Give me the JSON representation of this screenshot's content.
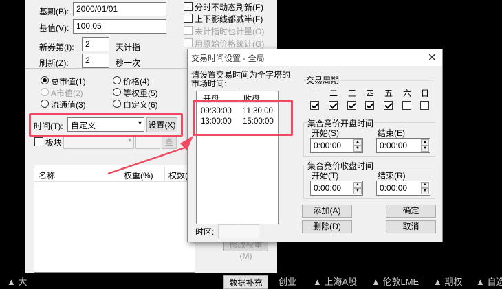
{
  "background": {
    "base_date_label": "基期(B):",
    "base_date_value": "2000/01/01",
    "base_value_label": "基值(V):",
    "base_value_value": "100.05",
    "new_stock_label": "新券第(I):",
    "new_stock_value": "2",
    "new_stock_suffix": "天计指",
    "refresh_label": "刷新(Z):",
    "refresh_value": "2",
    "refresh_suffix": "秒一次",
    "options": [
      {
        "label": "分时不动态刷新(E)",
        "checked": false,
        "disabled": false
      },
      {
        "label": "上下影线都减半(F)",
        "checked": false,
        "disabled": false
      },
      {
        "label": "未计指时也计量(O)",
        "checked": false,
        "disabled": true
      },
      {
        "label": "用原始价格统计(G)",
        "checked": false,
        "disabled": true
      }
    ],
    "weight_radios": [
      {
        "label": "总市值(1)",
        "checked": true,
        "disabled": false
      },
      {
        "label": "A市值(2)",
        "checked": false,
        "disabled": true
      },
      {
        "label": "流通值(3)",
        "checked": false,
        "disabled": false
      },
      {
        "label": "价格(4)",
        "checked": false,
        "disabled": false
      },
      {
        "label": "等权重(5)",
        "checked": false,
        "disabled": false
      },
      {
        "label": "自定义(6)",
        "checked": false,
        "disabled": false
      }
    ],
    "time_label": "时间(T):",
    "time_select_value": "自定义",
    "setup_button": "设置(X)",
    "sector_label": "板块",
    "query_button": "查",
    "table_headers": [
      "名称",
      "权重(%)",
      "权数("
    ],
    "modify_weight_button": "修改权重(M)",
    "data_fill_button": "数据补充"
  },
  "ticker": {
    "items": [
      "大",
      "创业",
      "上海A股",
      "伦敦LME",
      "期权",
      "自选"
    ]
  },
  "dialog": {
    "title": "交易时间设置 - 全局",
    "close_icon": "close-icon",
    "instruction": "请设置交易时间为全字塔的市场时间:",
    "columns": [
      "开盘",
      "收盘"
    ],
    "rows": [
      {
        "open": "09:30:00",
        "close": "11:30:00"
      },
      {
        "open": "13:00:00",
        "close": "15:00:00"
      }
    ],
    "timezone_label": "时区:",
    "timezone_value": "",
    "trading_cycle_label": "交易周期",
    "weekdays": [
      {
        "label": "一",
        "checked": true
      },
      {
        "label": "二",
        "checked": true
      },
      {
        "label": "三",
        "checked": true
      },
      {
        "label": "四",
        "checked": true
      },
      {
        "label": "五",
        "checked": true
      },
      {
        "label": "六",
        "checked": false
      },
      {
        "label": "日",
        "checked": false
      }
    ],
    "auction_open_label": "集合竞价开盘时间",
    "auction_open_start_label": "开始(S)",
    "auction_open_start_value": "0:00:00",
    "auction_open_end_label": "结束(E)",
    "auction_open_end_value": "0:00:00",
    "auction_close_label": "集合竞价收盘时间",
    "auction_close_start_label": "开始(T)",
    "auction_close_start_value": "0:00:00",
    "auction_close_end_label": "结束(R)",
    "auction_close_end_value": "0:00:00",
    "add_button": "添加(A)",
    "delete_button": "删除(D)",
    "ok_button": "确定",
    "cancel_button": "取消"
  },
  "colors": {
    "annotation": "#ef4a62",
    "dialog_bg": "#f0f0f0",
    "ticker_bg": "#000000"
  }
}
